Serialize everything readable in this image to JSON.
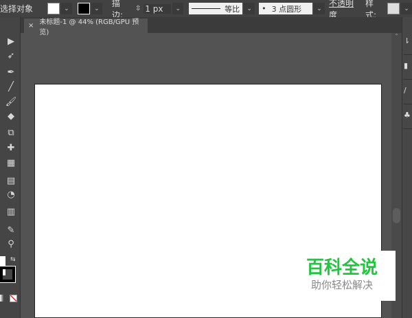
{
  "control_bar": {
    "select_label": "选择对象",
    "stroke_label": "描边:",
    "stroke_value": "1 px",
    "profile_label": "等比",
    "brush_label": "3 点圆形",
    "opacity_label": "不透明度",
    "style_label": "样式:"
  },
  "document_tab": {
    "close": "×",
    "title": "未标题-1 @ 44% (RGB/GPU 预览)"
  },
  "tools": [
    "selection",
    "lasso",
    "pen",
    "line",
    "brush",
    "eraser",
    "scale",
    "puppet-warp",
    "perspective-grid",
    "gradient",
    "shape-builder",
    "graph",
    "eyedropper",
    "zoom"
  ],
  "watermark": {
    "title": "百科全说",
    "subtitle": "助你轻松解决",
    "color": "#1ec83c"
  }
}
